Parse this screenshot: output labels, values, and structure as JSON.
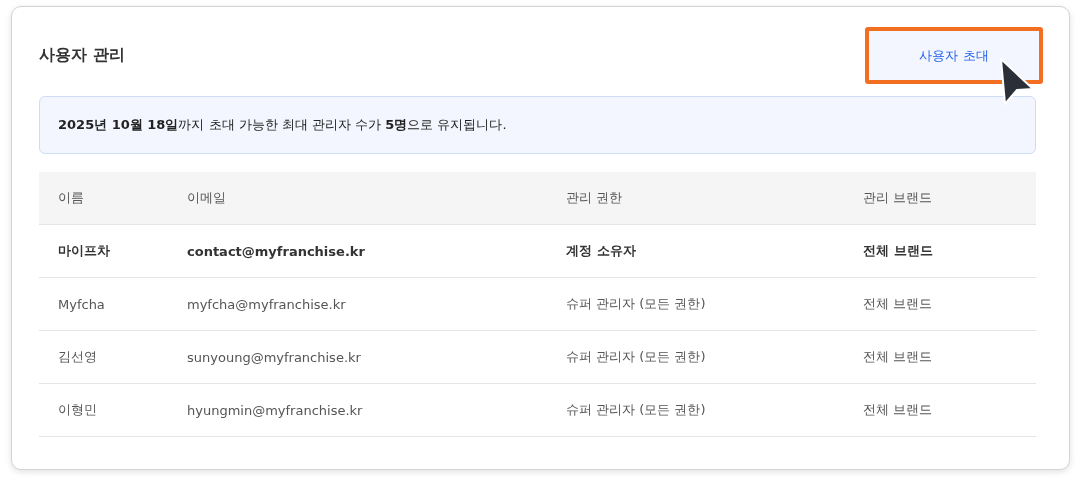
{
  "title": "사용자 관리",
  "invite_button": {
    "label": "사용자 초대",
    "highlighted": true
  },
  "notice": "**2025년 10월 18일**까지 초대 가능한 최대 관리자 수가 **5명**으로 유지됩니다.",
  "table": {
    "columns": [
      "이름",
      "이메일",
      "관리 권한",
      "관리 브랜드"
    ],
    "rows": [
      {
        "kind": "owner",
        "cells": [
          "마이프차",
          "contact@myfranchise.kr",
          "계정 소유자",
          "전체 브랜드"
        ]
      },
      {
        "kind": "member",
        "cells": [
          "Myfcha",
          "myfcha@myfranchise.kr",
          "슈퍼 관리자 (모든 권한)",
          "전체 브랜드"
        ]
      },
      {
        "kind": "member",
        "cells": [
          "김선영",
          "sunyoung@myfranchise.kr",
          "슈퍼 관리자 (모든 권한)",
          "전체 브랜드"
        ]
      },
      {
        "kind": "member",
        "cells": [
          "이형민",
          "hyungmin@myfranchise.kr",
          "슈퍼 관리자 (모든 권한)",
          "전체 브랜드"
        ]
      }
    ]
  }
}
